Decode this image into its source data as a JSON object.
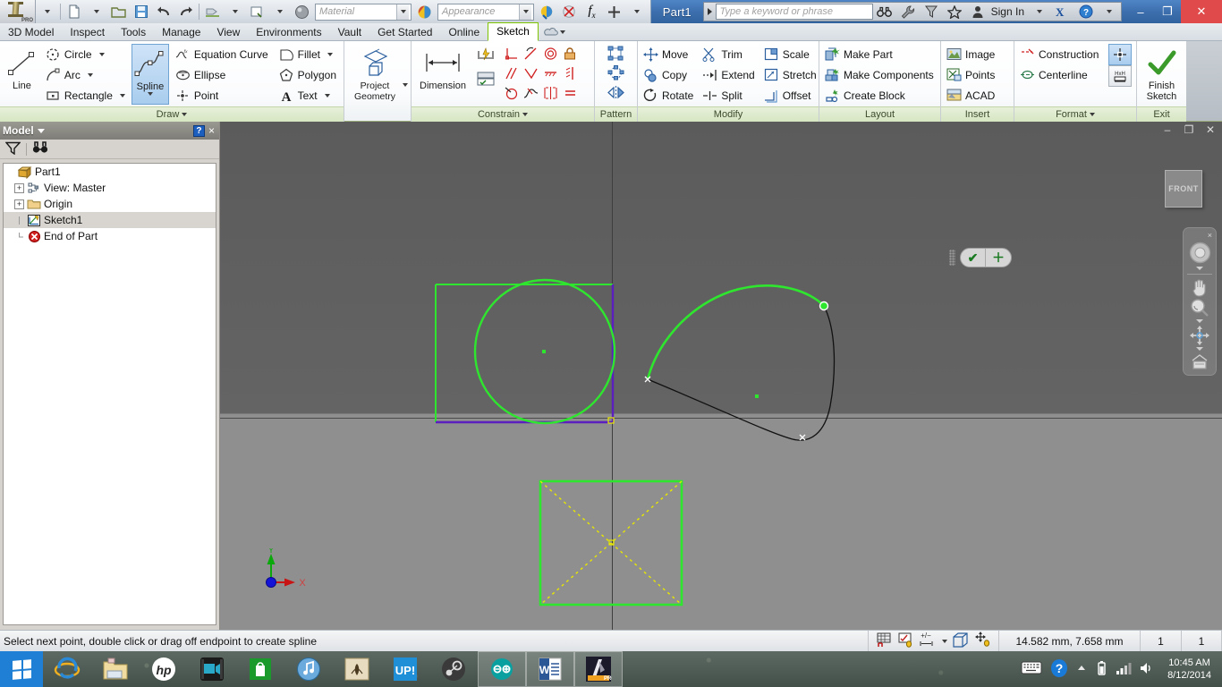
{
  "titlebar": {
    "document_title": "Part1",
    "material_placeholder": "Material",
    "appearance_placeholder": "Appearance",
    "search_placeholder": "Type a keyword or phrase",
    "sign_in": "Sign In",
    "minimize": "–",
    "restore": "❐",
    "close": "✕",
    "app_brand": "PRO",
    "icons": {
      "new": "new-document-icon",
      "open": "open-folder-icon",
      "save": "save-disk-icon",
      "undo": "undo-arrow-icon",
      "redo": "redo-arrow-icon",
      "material_swatch": "material-color-icon",
      "appearance_swatch": "appearance-color-icon",
      "fx": "fx-parameters-icon",
      "plus": "add-icon",
      "binoculars": "search-binoculars-icon",
      "wrench": "tools-wrench-icon",
      "funnel": "filter-icon",
      "star": "favorites-star-icon",
      "person": "account-person-icon",
      "exchange": "autodesk-exchange-icon",
      "help": "help-question-icon"
    }
  },
  "menu": {
    "items": [
      {
        "label": "3D Model",
        "active": false
      },
      {
        "label": "Inspect",
        "active": false
      },
      {
        "label": "Tools",
        "active": false
      },
      {
        "label": "Manage",
        "active": false
      },
      {
        "label": "View",
        "active": false
      },
      {
        "label": "Environments",
        "active": false
      },
      {
        "label": "Vault",
        "active": false
      },
      {
        "label": "Get Started",
        "active": false
      },
      {
        "label": "Online",
        "active": false
      },
      {
        "label": "Sketch",
        "active": true
      }
    ]
  },
  "ribbon": {
    "panels": [
      {
        "label": "Draw",
        "has_dropdown": true
      },
      {
        "label": "Constrain",
        "has_dropdown": true
      },
      {
        "label": "Pattern",
        "has_dropdown": false
      },
      {
        "label": "Modify",
        "has_dropdown": false
      },
      {
        "label": "Layout",
        "has_dropdown": false
      },
      {
        "label": "Insert",
        "has_dropdown": false
      },
      {
        "label": "Format",
        "has_dropdown": true
      },
      {
        "label": "Exit",
        "has_dropdown": false
      }
    ],
    "draw": {
      "line": "Line",
      "circle": "Circle",
      "arc": "Arc",
      "rectangle": "Rectangle",
      "spline": "Spline",
      "equation_curve": "Equation Curve",
      "ellipse": "Ellipse",
      "point": "Point",
      "fillet": "Fillet",
      "polygon": "Polygon",
      "text": "Text",
      "selected": "Spline"
    },
    "project": {
      "line1": "Project",
      "line2": "Geometry"
    },
    "constrain": {
      "dimension": "Dimension",
      "icons": [
        "auto-dimension-icon",
        "show-constraints-icon",
        "perpendicular-constraint-icon",
        "tangent-constraint-icon",
        "coincident-constraint-icon",
        "fix-constraint-icon",
        "parallel-constraint-icon",
        "collinear-constraint-icon",
        "horizontal-constraint-icon",
        "vertical-constraint-icon",
        "concentric-constraint-icon",
        "smooth-constraint-icon",
        "symmetric-constraint-icon",
        "equal-constraint-icon"
      ]
    },
    "pattern": {
      "icons": [
        "rectangular-pattern-icon",
        "circular-pattern-icon",
        "mirror-icon"
      ]
    },
    "modify": {
      "move": "Move",
      "copy": "Copy",
      "rotate": "Rotate",
      "trim": "Trim",
      "extend": "Extend",
      "split": "Split",
      "scale": "Scale",
      "stretch": "Stretch",
      "offset": "Offset"
    },
    "layout": {
      "make_part": "Make Part",
      "make_components": "Make Components",
      "create_block": "Create Block"
    },
    "insert": {
      "image": "Image",
      "points": "Points",
      "acad": "ACAD"
    },
    "format": {
      "construction": "Construction",
      "centerline": "Centerline",
      "icons": [
        "construction-format-icon",
        "driven-dimension-icon"
      ]
    },
    "exit": {
      "line1": "Finish",
      "line2": "Sketch"
    }
  },
  "browser": {
    "title": "Model",
    "help_badge": "?",
    "close": "×",
    "toolbar_icons": [
      "filter-icon",
      "find-binoculars-icon"
    ],
    "tree": [
      {
        "label": "Part1",
        "icon": "part-document-icon",
        "expander": "",
        "indent": 0,
        "selected": false
      },
      {
        "label": "View: Master",
        "icon": "view-master-icon",
        "expander": "+",
        "indent": 1,
        "selected": false
      },
      {
        "label": "Origin",
        "icon": "origin-folder-icon",
        "expander": "+",
        "indent": 1,
        "selected": false
      },
      {
        "label": "Sketch1",
        "icon": "sketch-icon",
        "expander": "",
        "indent": 1,
        "selected": true
      },
      {
        "label": "End of Part",
        "icon": "end-of-part-icon",
        "expander": "",
        "indent": 1,
        "selected": false
      }
    ]
  },
  "canvas": {
    "viewcube_label": "FRONT",
    "window_minimize": "–",
    "window_restore": "❐",
    "window_close": "✕",
    "nav_close": "×",
    "nav_items": [
      "steering-wheel-icon",
      "pan-hand-icon",
      "zoom-magnifier-icon",
      "orbit-icon",
      "look-at-icon"
    ],
    "axis_x_label": "X",
    "axis_y_label": "Y",
    "spline_popup": {
      "accept": "✔",
      "add": "＋",
      "grip": "drag-grip-icon"
    }
  },
  "statusbar": {
    "message": "Select next point, double click or drag off endpoint to create spline",
    "icons": [
      "snap-grid-icon",
      "constraint-inference-icon",
      "dimension-input-icon",
      "slice-graphics-icon",
      "dynamic-input-icon"
    ],
    "coordinates": "14.582 mm, 7.658 mm",
    "field2": "1",
    "field3": "1"
  },
  "taskbar": {
    "start": "start-button",
    "items": [
      {
        "name": "internet-explorer-icon",
        "active": false
      },
      {
        "name": "file-explorer-icon",
        "active": false
      },
      {
        "name": "hp-support-icon",
        "active": false
      },
      {
        "name": "video-app-icon",
        "active": false
      },
      {
        "name": "windows-store-icon",
        "active": false
      },
      {
        "name": "itunes-icon",
        "active": false
      },
      {
        "name": "evernote-icon",
        "active": false
      },
      {
        "name": "up-app-icon",
        "active": false
      },
      {
        "name": "steam-icon",
        "active": false
      },
      {
        "name": "arduino-icon",
        "active": true
      },
      {
        "name": "word-icon",
        "active": true
      },
      {
        "name": "inventor-icon",
        "active": true
      }
    ],
    "tray": [
      "keyboard-icon",
      "help-blue-icon",
      "show-hidden-icons-icon",
      "battery-icon",
      "network-signal-icon",
      "volume-icon"
    ],
    "time": "10:45 AM",
    "date": "8/12/2014"
  },
  "colors": {
    "accent_green": "#7ec400",
    "sketch_green": "#2fe62f",
    "construction_yellow": "#e8e800",
    "projected_purple": "#5a1fbe",
    "title_blue": "#3d6fae"
  }
}
